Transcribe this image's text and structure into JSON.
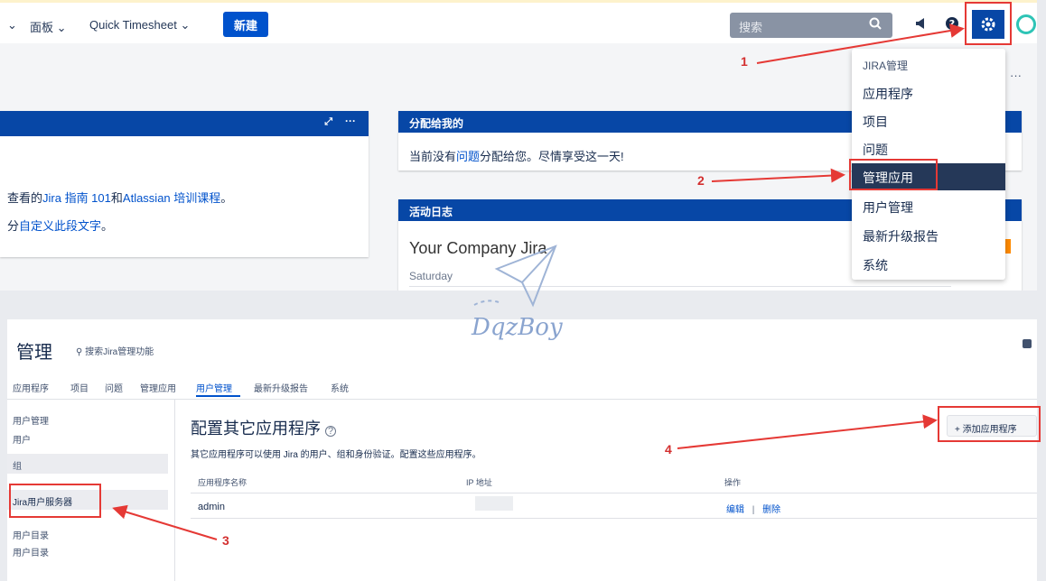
{
  "topbar": {
    "nav_chevron": "⌄",
    "dashboards": "面板",
    "quick_timesheet": "Quick Timesheet",
    "create": "新建",
    "search_placeholder": "搜索"
  },
  "panel_left": {
    "line1_pre": "查看的",
    "line1_link1": "Jira 指南 101",
    "line1_mid": "和",
    "line1_link2": "Atlassian 培训课程",
    "line1_post": "。",
    "line2_pre": "分",
    "line2_link": "自定义此段文字",
    "line2_post": "。"
  },
  "panel_assigned": {
    "title": "分配给我的",
    "text_pre": "当前没有",
    "text_link": "问题",
    "text_post": "分配给您。尽情享受这一天!"
  },
  "panel_activity": {
    "title": "活动日志",
    "company": "Your Company Jira",
    "day": "Saturday"
  },
  "menu": {
    "header": "JIRA管理",
    "items": [
      "应用程序",
      "项目",
      "问题",
      "管理应用",
      "用户管理",
      "最新升级报告",
      "系统"
    ]
  },
  "watermark": "DqzBoy",
  "admin": {
    "title": "管理",
    "search": "搜索Jira管理功能",
    "tabs": [
      "应用程序",
      "项目",
      "问题",
      "管理应用",
      "用户管理",
      "最新升级报告",
      "系统"
    ],
    "sidebar": {
      "section1": "用户管理",
      "users": "用户",
      "groups": "组",
      "jira_user_server": "Jira用户服务器",
      "section2": "用户目录",
      "directories": "用户目录"
    },
    "page_title": "配置其它应用程序",
    "description": "其它应用程序可以使用 Jira 的用户、组和身份验证。配置这些应用程序。",
    "add_button": "+ 添加应用程序",
    "table": {
      "headers": [
        "应用程序名称",
        "IP 地址",
        "操作"
      ],
      "row": {
        "name": "admin",
        "edit": "编辑",
        "sep": "|",
        "delete": "删除"
      }
    }
  },
  "annotations": [
    "1",
    "2",
    "3",
    "4"
  ],
  "colors": {
    "accent": "#0052cc",
    "header_blue": "#0747a6",
    "annotation_red": "#e53935"
  }
}
